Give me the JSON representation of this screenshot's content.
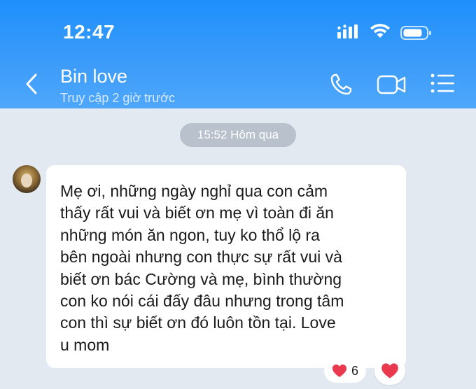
{
  "status_bar": {
    "time": "12:47"
  },
  "header": {
    "contact_name": "Bin love",
    "last_seen": "Truy cập 2 giờ trước",
    "icons": [
      "back-arrow-icon",
      "phone-icon",
      "video-call-icon",
      "menu-icon"
    ]
  },
  "chat": {
    "date_divider": "15:52 Hôm qua",
    "messages": [
      {
        "text": "Mẹ ơi, những ngày nghỉ qua con cảm\nthấy rất vui và biết ơn mẹ vì toàn đi ăn\nnhững món ăn ngon, tuy ko thổ lộ ra\nbên ngoài nhưng con thực sự rất vui và\nbiết ơn bác Cường và mẹ, bình thường\ncon ko nói cái đấy đâu nhưng trong tâm\ncon thì sự biết ơn đó luôn tồn tại. Love\nu mom",
        "reaction_count": "6"
      }
    ]
  },
  "colors": {
    "header": "#3d9cf9",
    "background": "#e2e9f1",
    "date_pill": "#b8c1cc",
    "heart": "#e8394f"
  }
}
